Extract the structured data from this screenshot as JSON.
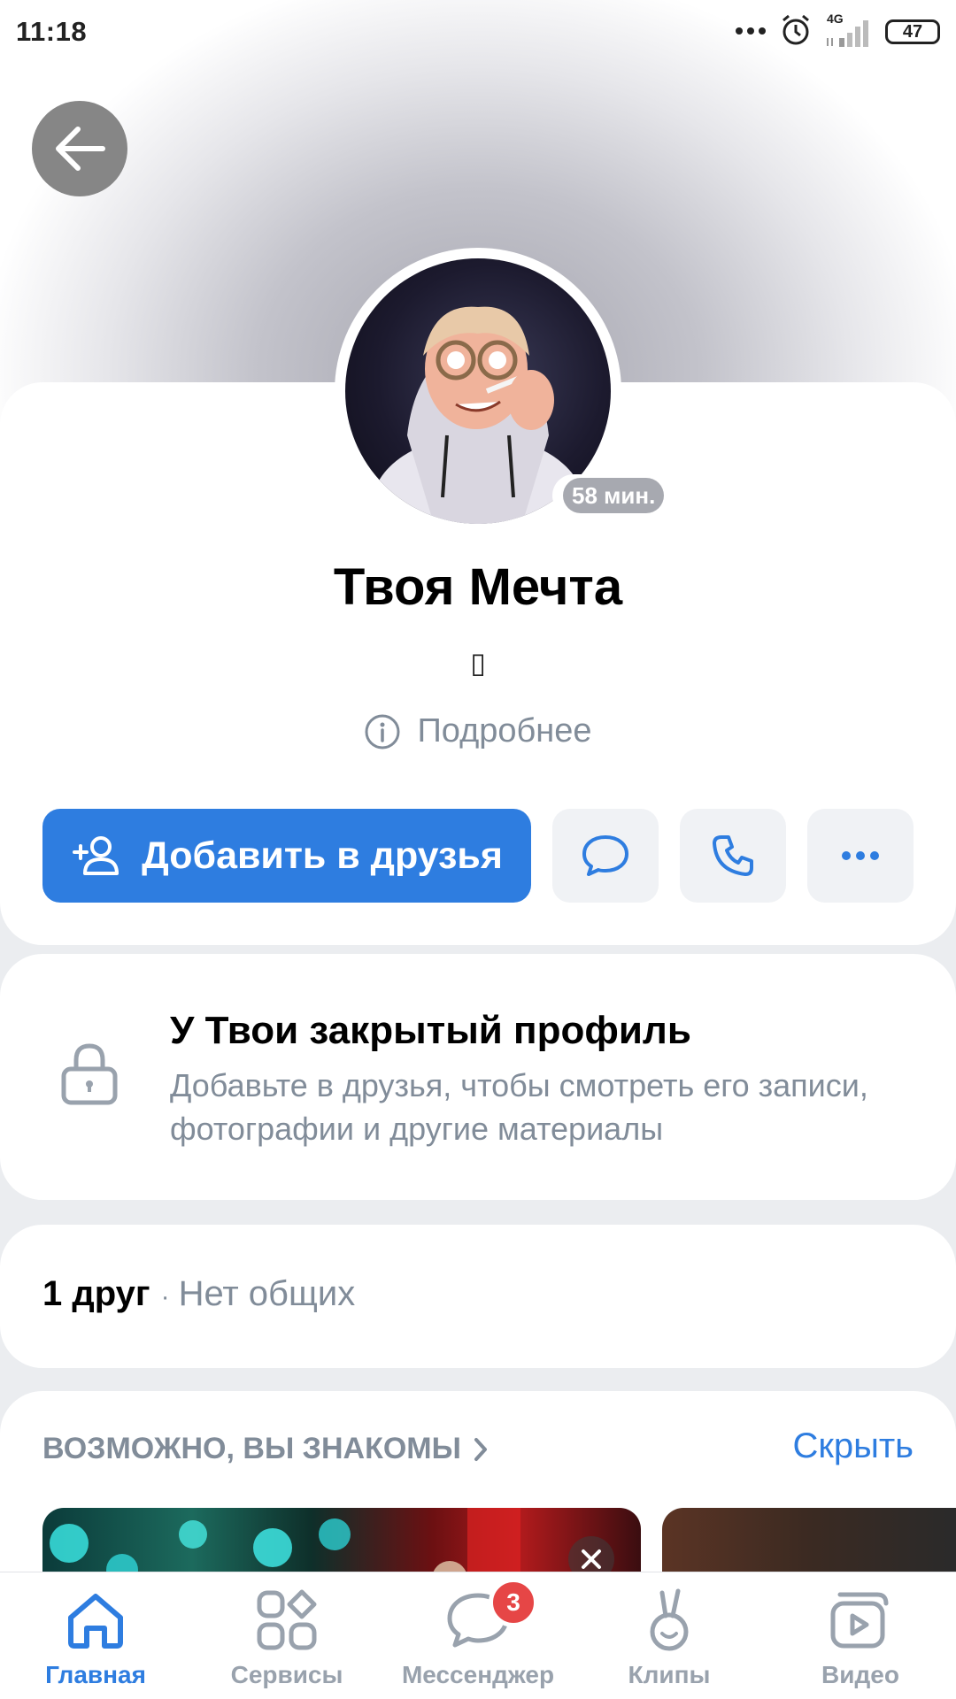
{
  "status_bar": {
    "time": "11:18",
    "network": "4G",
    "battery": "47"
  },
  "profile": {
    "name": "Твоя Мечта",
    "status_glyph": "▯",
    "online_ago": "58 мин.",
    "details_link": "Подробнее"
  },
  "actions": {
    "add_friend": "Добавить в друзья",
    "message_icon": "message-icon",
    "call_icon": "phone-icon",
    "more_icon": "more-icon"
  },
  "closed_profile": {
    "title": "У Твои закрытый профиль",
    "description": "Добавьте в друзья, чтобы смотреть его записи, фотографии и другие материалы"
  },
  "friends": {
    "count": "1 друг",
    "separator": "·",
    "common": "Нет общих"
  },
  "suggestions": {
    "title": "ВОЗМОЖНО, ВЫ ЗНАКОМЫ",
    "hide": "Скрыть"
  },
  "bottom_nav": {
    "items": [
      {
        "label": "Главная",
        "icon": "home-icon",
        "active": true
      },
      {
        "label": "Сервисы",
        "icon": "services-icon",
        "active": false
      },
      {
        "label": "Мессенджер",
        "icon": "messenger-icon",
        "active": false,
        "badge": "3"
      },
      {
        "label": "Клипы",
        "icon": "clips-icon",
        "active": false
      },
      {
        "label": "Видео",
        "icon": "video-icon",
        "active": false
      }
    ]
  },
  "colors": {
    "accent": "#2e7de0",
    "secondary_text": "#818c99",
    "badge": "#e64646"
  }
}
